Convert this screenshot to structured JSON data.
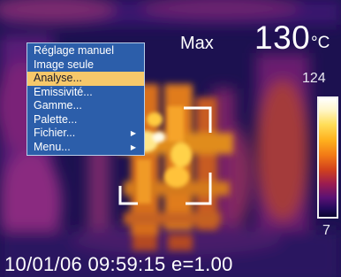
{
  "header": {
    "max_label": "Max",
    "max_value": "130",
    "unit": "°C"
  },
  "scale": {
    "high": "124",
    "low": "7"
  },
  "status": {
    "date": "10/01/06",
    "time": "09:59:15",
    "emissivity": "e=1.00"
  },
  "menu": {
    "items": [
      {
        "label": "Réglage manuel",
        "submenu": false,
        "selected": false
      },
      {
        "label": "Image seule",
        "submenu": false,
        "selected": false
      },
      {
        "label": "Analyse...",
        "submenu": false,
        "selected": true
      },
      {
        "label": "Emissivité...",
        "submenu": false,
        "selected": false
      },
      {
        "label": "Gamme...",
        "submenu": false,
        "selected": false
      },
      {
        "label": "Palette...",
        "submenu": false,
        "selected": false
      },
      {
        "label": "Fichier...",
        "submenu": true,
        "selected": false
      },
      {
        "label": "Menu...",
        "submenu": true,
        "selected": false
      }
    ],
    "submenu_icon": "triangle-right-icon"
  },
  "colors": {
    "menu_background": "#2c5eaa",
    "menu_selected": "#f6c86a",
    "hud_text": "#ffffff"
  }
}
